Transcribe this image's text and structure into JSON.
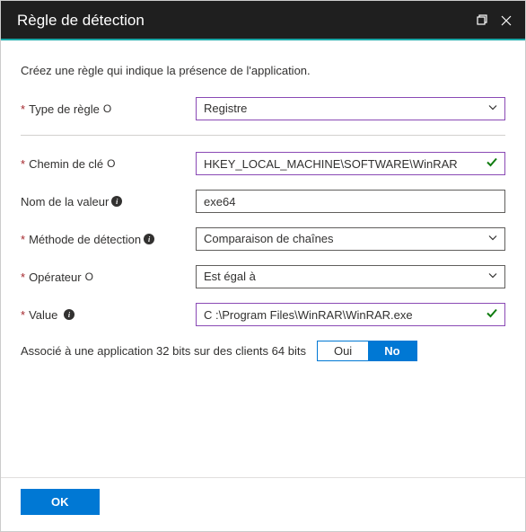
{
  "header": {
    "title": "Règle de détection"
  },
  "intro": "Créez une règle qui indique la présence de l'application.",
  "fields": {
    "ruleType": {
      "label": "Type de règle",
      "value": "Registre"
    },
    "keyPath": {
      "label": "Chemin de clé",
      "value": "HKEY_LOCAL_MACHINE\\SOFTWARE\\WinRAR"
    },
    "valueName": {
      "label": "Nom de la valeur",
      "value": "exe64"
    },
    "detectionMethod": {
      "label": "Méthode de détection",
      "value": "Comparaison de chaînes"
    },
    "operator": {
      "label": "Opérateur",
      "value": "Est égal à"
    },
    "value": {
      "label": "Value",
      "value": "C :\\Program Files\\WinRAR\\WinRAR.exe"
    }
  },
  "assoc32": {
    "label": "Associé à une application 32 bits sur des clients 64 bits",
    "yes": "Oui",
    "no": "No",
    "selected": "no"
  },
  "footer": {
    "ok": "OK"
  }
}
